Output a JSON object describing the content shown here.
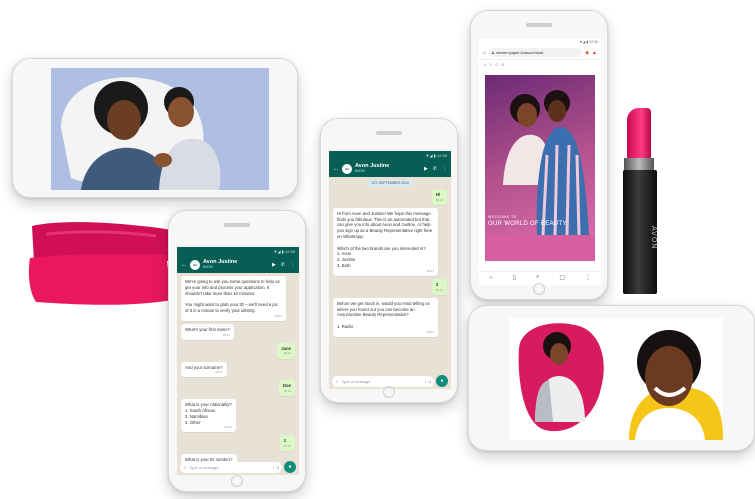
{
  "colors": {
    "whatsapp_green": "#075e54",
    "avon_pink": "#d65fa0",
    "lipstick_pink": "#e91e63",
    "accent_yellow": "#f5c518"
  },
  "chat_left": {
    "statusbar": "▼◢ ▮ 12:30",
    "contact_name": "Avon Justine",
    "contact_sub": "AVON",
    "messages": [
      {
        "dir": "in",
        "text": "We're going to ask you some questions to help us get your info and process your application. It shouldn't take more than 10 minutes.\n\nYou might want to grab your ID – we'll need a pic of it in a minute to verify your identity.",
        "time": "09:11"
      },
      {
        "dir": "in",
        "text": "What's your first name?",
        "time": "09:11"
      },
      {
        "dir": "out",
        "text": "Jane",
        "time": "09:11"
      },
      {
        "dir": "in",
        "text": "And your surname?",
        "time": "09:11"
      },
      {
        "dir": "out",
        "text": "Doe",
        "time": "09:11"
      },
      {
        "dir": "in",
        "text": "What is your nationality?\n1. South African\n2. Namibian\n3. Other",
        "time": "09:11"
      },
      {
        "dir": "out",
        "text": "1",
        "time": "09:11"
      },
      {
        "dir": "in",
        "text": "What is your ID number?",
        "time": "09:11"
      }
    ],
    "composer_placeholder": "Type a message"
  },
  "chat_mid": {
    "statusbar": "▼◢ ▮ 12:30",
    "contact_name": "Avon Justine",
    "contact_sub": "AVON",
    "date": "1ST SEPTEMBER 2019",
    "messages": [
      {
        "dir": "out",
        "text": "Hi",
        "time": "09:11"
      },
      {
        "dir": "in",
        "text": "Hi from Avon and Justine! We hope this message finds you fabulous. This is an automated bot that can give you info about Avon and Justine, or help you sign up as a Beauty Representative right here on WhatsApp.\n\nWhich of the two brands are you interested in?\n1. Avon\n2. Justine\n3. Both",
        "time": "09:11"
      },
      {
        "dir": "out",
        "text": "3",
        "time": "09:11"
      },
      {
        "dir": "in",
        "text": "Before we get stuck in, would you mind telling us where you found out you can become an Avon/Justine Beauty Representative?\n\n1. Radio",
        "time": "09:11"
      }
    ],
    "composer_placeholder": "Type a message"
  },
  "browser": {
    "statusbar": "▼◢ ▮ 12:30",
    "url": "viewer.ipaper.io/avon/most",
    "brand_header": "A V O N",
    "caption_small": "WELCOME TO",
    "caption_large": "OUR WORLD OF BEAUTY"
  },
  "lipstick": {
    "brand": "AVON"
  }
}
